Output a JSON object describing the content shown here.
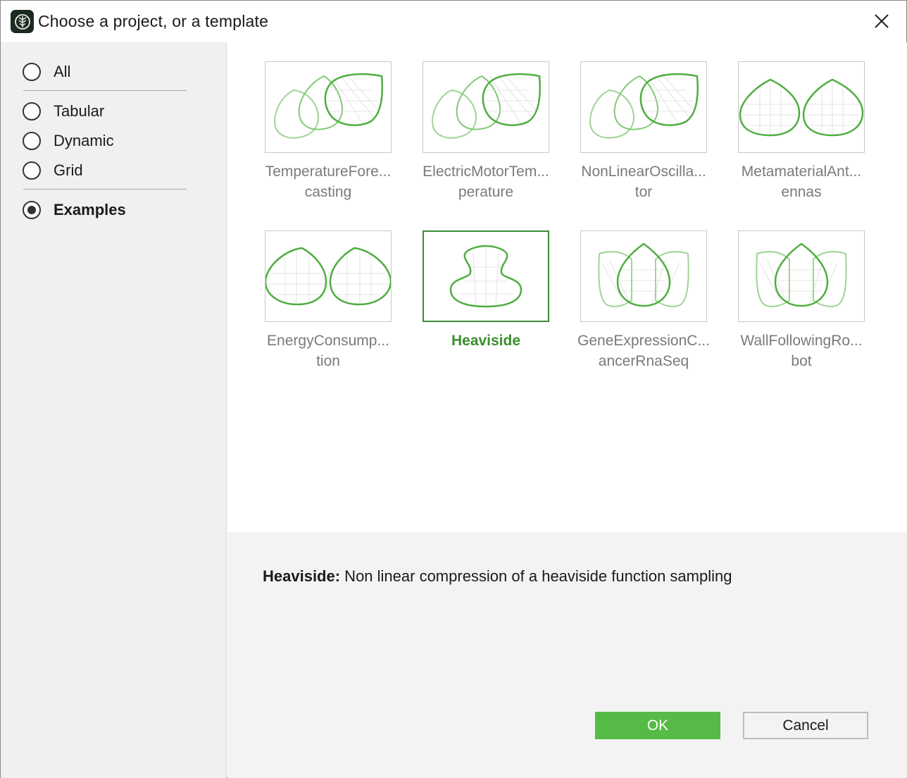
{
  "window": {
    "title": "Choose a project, or a template"
  },
  "sidebar": {
    "options": [
      {
        "label": "All",
        "checked": false
      },
      {
        "label": "Tabular",
        "checked": false
      },
      {
        "label": "Dynamic",
        "checked": false
      },
      {
        "label": "Grid",
        "checked": false
      },
      {
        "label": "Examples",
        "checked": true
      }
    ]
  },
  "templates": [
    {
      "label": "TemperatureFore...\ncasting",
      "icon": "overlapping-drops-icon",
      "selected": false
    },
    {
      "label": "ElectricMotorTem...\nperature",
      "icon": "overlapping-drops-icon",
      "selected": false
    },
    {
      "label": "NonLinearOscilla...\ntor",
      "icon": "overlapping-drops-icon",
      "selected": false
    },
    {
      "label": "MetamaterialAnt...\nennas",
      "icon": "twin-drops-icon",
      "selected": false
    },
    {
      "label": "EnergyConsump...\ntion",
      "icon": "twin-drops-icon",
      "selected": false
    },
    {
      "label": "Heaviside",
      "icon": "vase-icon",
      "selected": true
    },
    {
      "label": "GeneExpressionC...\nancerRnaSeq",
      "icon": "lotus-icon",
      "selected": false
    },
    {
      "label": "WallFollowingRo...\nbot",
      "icon": "lotus-icon",
      "selected": false
    }
  ],
  "details": {
    "name": "Heaviside:",
    "description": " Non linear compression of a heaviside function sampling"
  },
  "buttons": {
    "ok": "OK",
    "cancel": "Cancel"
  },
  "colors": {
    "accent": "#56bb46",
    "selected_text": "#3b8e2e",
    "icon_stroke": "#5cb84d",
    "icon_stroke_light": "#9fd495"
  }
}
